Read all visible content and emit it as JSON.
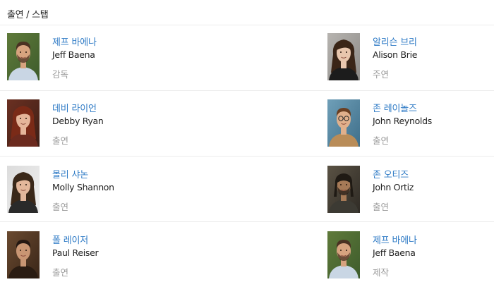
{
  "section": {
    "title": "출연 / 스탭"
  },
  "cast": [
    {
      "name_ko": "제프 바에나",
      "name_en": "Jeff Baena",
      "role": "감독",
      "photo_icon": "man-portrait-beard",
      "colors": {
        "bg": "#3e5c2c",
        "bg2": "#5f7a3a",
        "skin": "#d7a37f",
        "hair": "#4a3122",
        "clothes": "#c9d6e4"
      }
    },
    {
      "name_ko": "알리슨 브리",
      "name_en": "Alison Brie",
      "role": "주연",
      "photo_icon": "woman-portrait-dark-hair",
      "colors": {
        "bg": "#8c8a87",
        "bg2": "#b7b4b0",
        "skin": "#e8c6ad",
        "hair": "#3a2517",
        "clothes": "#1c1c1c"
      }
    },
    {
      "name_ko": "데비 라이언",
      "name_en": "Debby Ryan",
      "role": "출연",
      "photo_icon": "woman-portrait-red-hair",
      "colors": {
        "bg": "#3d1f16",
        "bg2": "#6b3022",
        "skin": "#e5b59a",
        "hair": "#7a2a17",
        "clothes": "#6b2a1e"
      }
    },
    {
      "name_ko": "존 레이놀즈",
      "name_en": "John Reynolds",
      "role": "출연",
      "photo_icon": "man-portrait-glasses",
      "colors": {
        "bg": "#3f6f8a",
        "bg2": "#6f9fb8",
        "skin": "#e0b08c",
        "hair": "#6a3f22",
        "clothes": "#b98c58"
      }
    },
    {
      "name_ko": "몰리 샤논",
      "name_en": "Molly Shannon",
      "role": "출연",
      "photo_icon": "woman-portrait-brown-hair",
      "colors": {
        "bg": "#efefef",
        "bg2": "#dcdcdc",
        "skin": "#e3b79b",
        "hair": "#3a2819",
        "clothes": "#2a2a2a"
      }
    },
    {
      "name_ko": "존 오티즈",
      "name_en": "John Ortiz",
      "role": "출연",
      "photo_icon": "man-portrait-dreadlocks",
      "colors": {
        "bg": "#2f2b25",
        "bg2": "#5a5244",
        "skin": "#a67a57",
        "hair": "#1f1a14",
        "clothes": "#3c3a33"
      }
    },
    {
      "name_ko": "폴 레이저",
      "name_en": "Paul Reiser",
      "role": "출연",
      "photo_icon": "man-portrait-dark-suit",
      "colors": {
        "bg": "#3a2618",
        "bg2": "#6a4a30",
        "skin": "#c99673",
        "hair": "#241812",
        "clothes": "#2a1c12"
      }
    },
    {
      "name_ko": "제프 바에나",
      "name_en": "Jeff Baena",
      "role": "제작",
      "photo_icon": "man-portrait-beard",
      "colors": {
        "bg": "#3e5c2c",
        "bg2": "#5f7a3a",
        "skin": "#d7a37f",
        "hair": "#4a3122",
        "clothes": "#c9d6e4"
      }
    }
  ]
}
